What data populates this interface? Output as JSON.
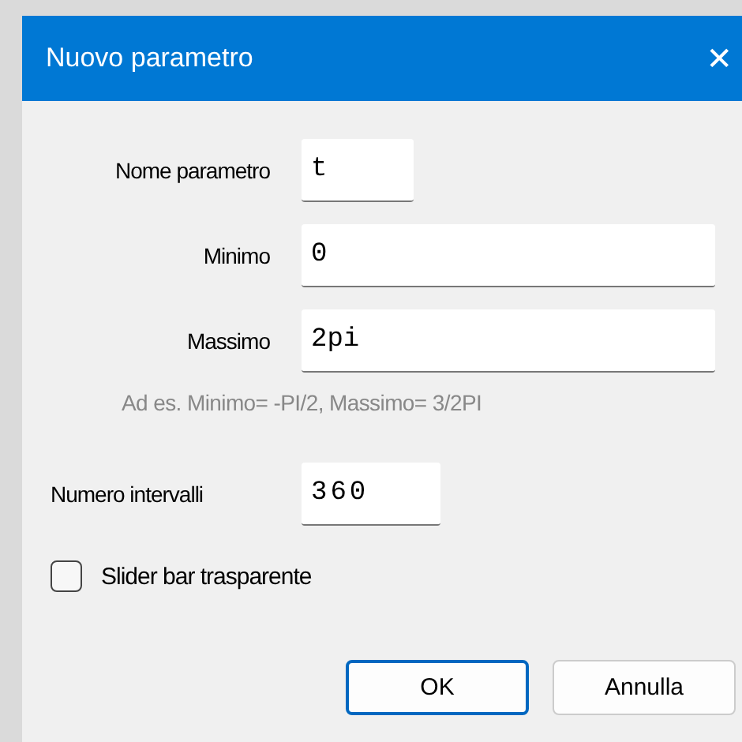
{
  "window": {
    "title": "Nuovo parametro",
    "close": "✕"
  },
  "fields": [
    {
      "label": "Nome parametro",
      "value": "t"
    },
    {
      "label": "Minimo",
      "value": "0"
    },
    {
      "label": "Massimo",
      "value": "2pi"
    }
  ],
  "hint": "Ad es. Minimo= -PI/2, Massimo= 3/2PI",
  "intervals": {
    "label": "Numero intervalli",
    "value": "360"
  },
  "checkbox": {
    "label": "Slider bar trasparente",
    "checked": false
  },
  "buttons": [
    {
      "label": "OK",
      "default": true
    },
    {
      "label": "Annulla",
      "default": false
    }
  ]
}
